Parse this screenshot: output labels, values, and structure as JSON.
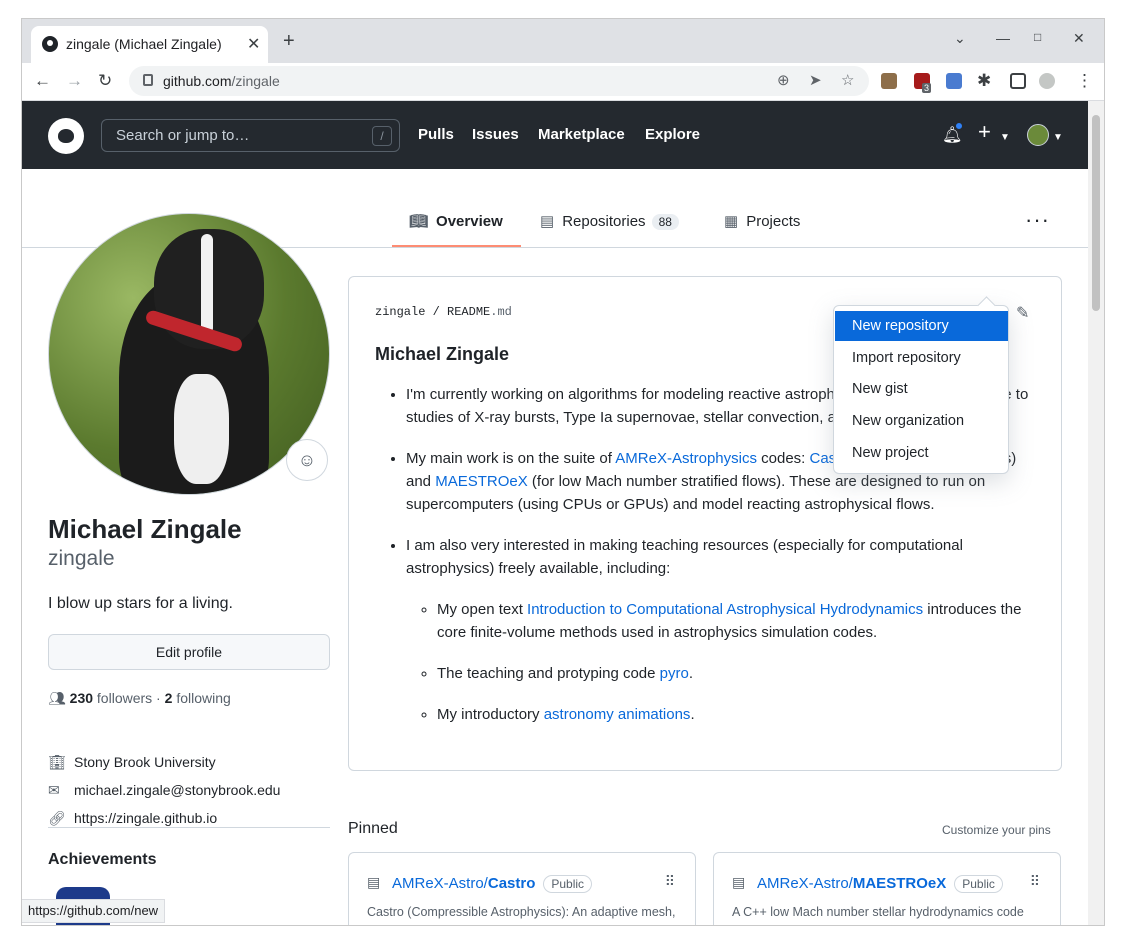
{
  "browser": {
    "tab_title": "zingale (Michael Zingale)",
    "url_host": "github.com",
    "url_path": "/zingale",
    "extension_badge": "3",
    "status_url": "https://github.com/new"
  },
  "header": {
    "search_placeholder": "Search or jump to…",
    "search_key": "/",
    "nav": [
      "Pulls",
      "Issues",
      "Marketplace",
      "Explore"
    ]
  },
  "profile_tabs": [
    {
      "label": "Overview",
      "count": ""
    },
    {
      "label": "Repositories",
      "count": "88"
    },
    {
      "label": "Projects",
      "count": ""
    }
  ],
  "create_menu": [
    "New repository",
    "Import repository",
    "New gist",
    "New organization",
    "New project"
  ],
  "profile": {
    "name": "Michael Zingale",
    "login": "zingale",
    "bio": "I blow up stars for a living.",
    "edit_label": "Edit profile",
    "followers": "230",
    "followers_label": "followers",
    "following": "2",
    "following_label": "following",
    "company": "Stony Brook University",
    "email": "michael.zingale@stonybrook.edu",
    "website": "https://zingale.github.io",
    "achievements_label": "Achievements"
  },
  "readme": {
    "path_user": "zingale",
    "path_file": "README",
    "path_ext": ".md",
    "title": "Michael Zingale",
    "b1": "I'm currently working on algorithms for modeling reactive astrophysics flows, applying these to studies of X-ray bursts, Type Ia supernovae, stellar convection, and novae.",
    "b2_pre": "My main work is on the suite of ",
    "b2_link1": "AMReX-Astrophysics",
    "b2_mid1": " codes: ",
    "b2_link2": "Castro",
    "b2_mid2": " (for compressible flows) and ",
    "b2_link3": "MAESTROeX",
    "b2_post": " (for low Mach number stratified flows). These are designed to run on supercomputers (using CPUs or GPUs) and model reacting astrophysical flows.",
    "b3": "I am also very interested in making teaching resources (especially for computational astrophysics) freely available, including:",
    "s1_pre": "My open text ",
    "s1_link": "Introduction to Computational Astrophysical Hydrodynamics",
    "s1_post": " introduces the core finite-volume methods used in astrophysics simulation codes.",
    "s2_pre": "The teaching and protyping code ",
    "s2_link": "pyro",
    "s2_post": ".",
    "s3_pre": "My introductory ",
    "s3_link": "astronomy animations",
    "s3_post": "."
  },
  "pinned": {
    "label": "Pinned",
    "customize": "Customize your pins",
    "items": [
      {
        "owner": "AMReX-Astro/",
        "repo": "Castro",
        "visibility": "Public",
        "desc": "Castro (Compressible Astrophysics): An adaptive mesh, astrophysical compressible (radiation-,"
      },
      {
        "owner": "AMReX-Astro/",
        "repo": "MAESTROeX",
        "visibility": "Public",
        "desc": "A C++ low Mach number stellar hydrodynamics code"
      }
    ]
  }
}
